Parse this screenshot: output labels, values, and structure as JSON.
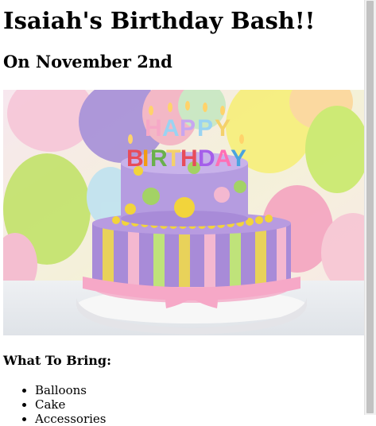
{
  "page": {
    "title": "Isaiah's Birthday Bash!!",
    "subtitle": "On November 2nd",
    "hero_image": {
      "candle_text": "HAPPY BIRTHDAY",
      "candle_colors": [
        "#e74c5a",
        "#f39c12",
        "#6ab04c",
        "#4aa3df",
        "#a55eea",
        "#ff6fb5"
      ]
    },
    "section_heading": "What To Bring:",
    "bring_items": [
      "Balloons",
      "Cake",
      "Accessories"
    ]
  },
  "colors": {
    "background": "#ffffff",
    "text": "#000000",
    "scrollbar_track": "#f0f0f0",
    "scrollbar_thumb": "#c2c2c2"
  }
}
